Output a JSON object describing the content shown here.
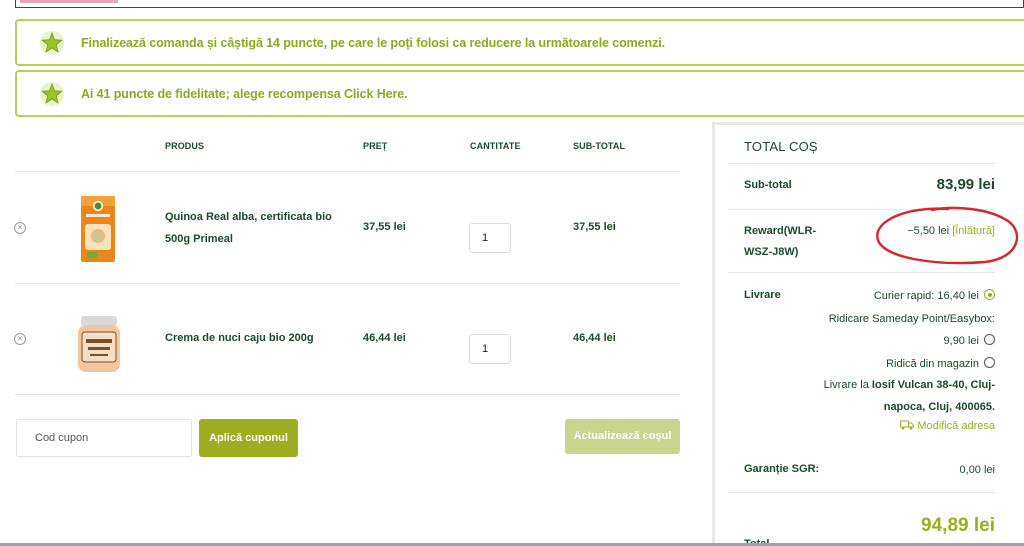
{
  "notices": [
    {
      "text": "Finalizează comanda și câștigă 14 puncte, pe care le poți folosi ca reducere la următoarele comenzi."
    },
    {
      "text": "Ai 41 puncte de fidelitate; alege recompensa Click Here."
    }
  ],
  "cart": {
    "headers": {
      "product": "PRODUS",
      "price": "PREȚ",
      "quantity": "CANTITATE",
      "subtotal": "SUB-TOTAL"
    },
    "items": [
      {
        "name": "Quinoa Real alba, certificata bio 500g Primeal",
        "price": "37,55 lei",
        "qty": "1",
        "subtotal": "37,55 lei",
        "image": "quinoa-box"
      },
      {
        "name": "Crema de nuci caju bio 200g",
        "price": "46,44 lei",
        "qty": "1",
        "subtotal": "46,44 lei",
        "image": "cashew-cream-jar"
      }
    ],
    "coupon_placeholder": "Cod cupon",
    "apply_label": "Aplică cuponul",
    "update_label": "Actualizează coșul"
  },
  "totals": {
    "title": "TOTAL COȘ",
    "subtotal_label": "Sub-total",
    "subtotal_value": "83,99 lei",
    "reward_label": "Reward(WLR-WSZ-J8W)",
    "reward_value": "−5,50 lei",
    "reward_remove": "[Înlătură]",
    "shipping_label": "Livrare",
    "shipping_options": [
      {
        "label": "Curier rapid: 16,40 lei",
        "selected": true
      },
      {
        "label": "Ridicare Sameday Point/Easybox:",
        "price": "9,90 lei",
        "selected": false
      },
      {
        "label": "Ridică din magazin",
        "selected": false
      }
    ],
    "delivery_prefix": "Livrare la",
    "delivery_address": "Iosif Vulcan 38-40, Cluj-napoca, Cluj, 400065",
    "delivery_address_line1": "Iosif Vulcan 38-40, Cluj-",
    "delivery_address_line2": "napoca, Cluj, 400065",
    "change_address": "Modifică adresa",
    "sgr_label": "Garanție SGR:",
    "sgr_value": "0,00 lei",
    "total_value": "94,89 lei",
    "total_label": "Total"
  },
  "colors": {
    "accent": "#9cae1f",
    "notice_text": "#8aab1e",
    "heading": "#1d4a2a",
    "annotation": "#d8262a"
  }
}
